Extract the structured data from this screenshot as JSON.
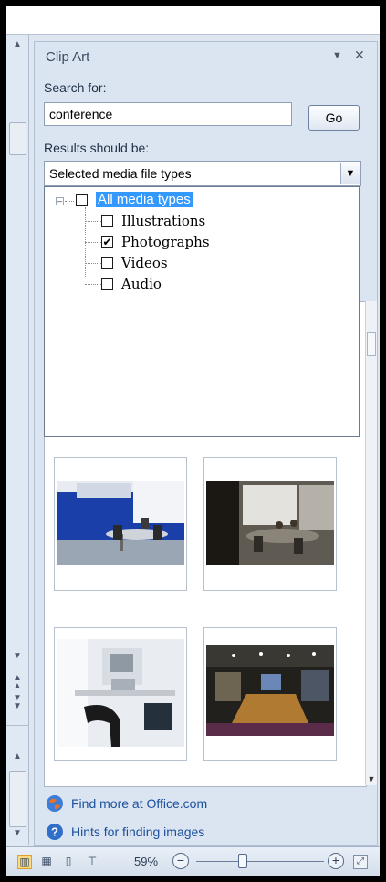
{
  "pane": {
    "title": "Clip Art",
    "menu_glyph": "▼",
    "close_glyph": "✕"
  },
  "search": {
    "label": "Search for:",
    "value": "conference",
    "go_label": "Go"
  },
  "results_filter": {
    "label": "Results should be:",
    "selected": "Selected media file types"
  },
  "media_types": {
    "root": {
      "label": "All media types",
      "checked": false
    },
    "items": [
      {
        "label": "Illustrations",
        "checked": false
      },
      {
        "label": "Photographs",
        "checked": true
      },
      {
        "label": "Videos",
        "checked": false
      },
      {
        "label": "Audio",
        "checked": false
      }
    ]
  },
  "links": {
    "find_more": "Find more at Office.com",
    "hints": "Hints for finding images"
  },
  "statusbar": {
    "zoom": "59%"
  },
  "icons": {
    "office_link": "office-globe-icon",
    "help": "help-icon",
    "view_normal": "normal-view-icon",
    "view_sorter": "slide-sorter-icon",
    "view_reading": "reading-view-icon",
    "view_show": "slide-show-icon",
    "fit": "fit-to-window-icon"
  },
  "colors": {
    "selection": "#3399ff",
    "link": "#1a4f9c",
    "pane_bg": "#dbe5f1"
  }
}
